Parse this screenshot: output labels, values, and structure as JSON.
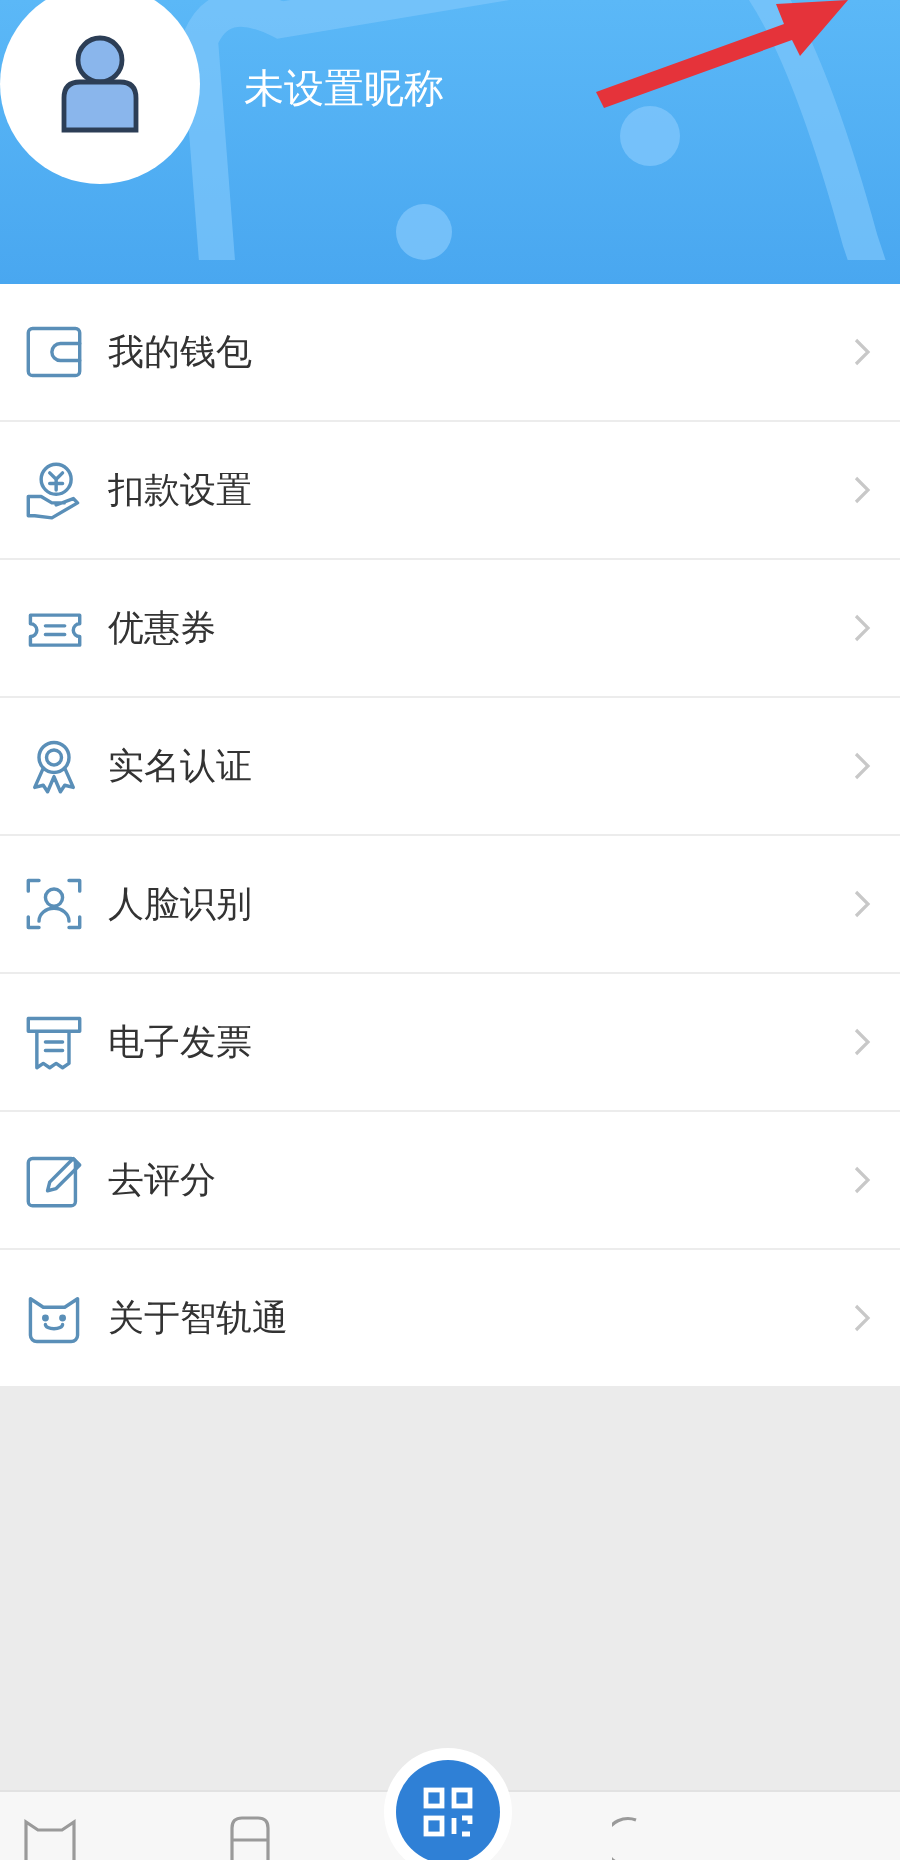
{
  "profile": {
    "nickname": "未设置昵称"
  },
  "menu": [
    {
      "label": "我的钱包"
    },
    {
      "label": "扣款设置"
    },
    {
      "label": "优惠券"
    },
    {
      "label": "实名认证"
    },
    {
      "label": "人脸识别"
    },
    {
      "label": "电子发票"
    },
    {
      "label": "去评分"
    },
    {
      "label": "关于智轨通"
    }
  ]
}
